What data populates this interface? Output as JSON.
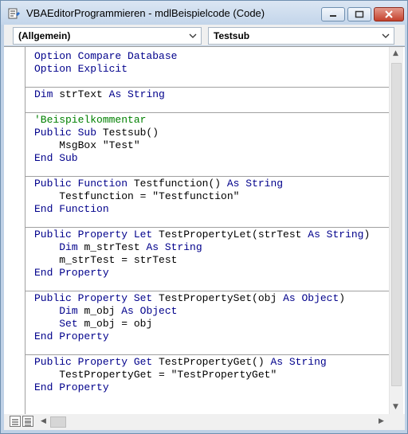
{
  "window": {
    "title": "VBAEditorProgrammieren - mdlBeispielcode (Code)",
    "icon": "vba-module-icon",
    "controls": [
      "minimize",
      "maximize",
      "close"
    ]
  },
  "object_combo": {
    "value": "(Allgemein)"
  },
  "procedure_combo": {
    "value": "Testsub"
  },
  "code_lines": [
    {
      "kind": "text",
      "segments": [
        {
          "t": "Option Compare Database",
          "c": "kw"
        }
      ]
    },
    {
      "kind": "text",
      "segments": [
        {
          "t": "Option Explicit",
          "c": "kw"
        }
      ]
    },
    {
      "kind": "blank"
    },
    {
      "kind": "text",
      "separator_before": true,
      "segments": [
        {
          "t": "Dim ",
          "c": "kw"
        },
        {
          "t": "strText ",
          "c": ""
        },
        {
          "t": "As String",
          "c": "kw"
        }
      ]
    },
    {
      "kind": "blank"
    },
    {
      "kind": "text",
      "separator_before": true,
      "segments": [
        {
          "t": "'Beispielkommentar",
          "c": "cm"
        }
      ]
    },
    {
      "kind": "text",
      "segments": [
        {
          "t": "Public Sub ",
          "c": "kw"
        },
        {
          "t": "Testsub()",
          "c": ""
        }
      ]
    },
    {
      "kind": "text",
      "segments": [
        {
          "t": "    MsgBox \"Test\"",
          "c": ""
        }
      ]
    },
    {
      "kind": "text",
      "segments": [
        {
          "t": "End Sub",
          "c": "kw"
        }
      ]
    },
    {
      "kind": "blank"
    },
    {
      "kind": "text",
      "separator_before": true,
      "segments": [
        {
          "t": "Public Function ",
          "c": "kw"
        },
        {
          "t": "Testfunction() ",
          "c": ""
        },
        {
          "t": "As String",
          "c": "kw"
        }
      ]
    },
    {
      "kind": "text",
      "segments": [
        {
          "t": "    Testfunction = \"Testfunction\"",
          "c": ""
        }
      ]
    },
    {
      "kind": "text",
      "segments": [
        {
          "t": "End Function",
          "c": "kw"
        }
      ]
    },
    {
      "kind": "blank"
    },
    {
      "kind": "text",
      "separator_before": true,
      "segments": [
        {
          "t": "Public Property Let ",
          "c": "kw"
        },
        {
          "t": "TestPropertyLet(strTest ",
          "c": ""
        },
        {
          "t": "As String",
          "c": "kw"
        },
        {
          "t": ")",
          "c": ""
        }
      ]
    },
    {
      "kind": "text",
      "segments": [
        {
          "t": "    ",
          "c": ""
        },
        {
          "t": "Dim ",
          "c": "kw"
        },
        {
          "t": "m_strTest ",
          "c": ""
        },
        {
          "t": "As String",
          "c": "kw"
        }
      ]
    },
    {
      "kind": "text",
      "segments": [
        {
          "t": "    m_strTest = strTest",
          "c": ""
        }
      ]
    },
    {
      "kind": "text",
      "segments": [
        {
          "t": "End Property",
          "c": "kw"
        }
      ]
    },
    {
      "kind": "blank"
    },
    {
      "kind": "text",
      "separator_before": true,
      "segments": [
        {
          "t": "Public Property Set ",
          "c": "kw"
        },
        {
          "t": "TestPropertySet(obj ",
          "c": ""
        },
        {
          "t": "As Object",
          "c": "kw"
        },
        {
          "t": ")",
          "c": ""
        }
      ]
    },
    {
      "kind": "text",
      "segments": [
        {
          "t": "    ",
          "c": ""
        },
        {
          "t": "Dim ",
          "c": "kw"
        },
        {
          "t": "m_obj ",
          "c": ""
        },
        {
          "t": "As Object",
          "c": "kw"
        }
      ]
    },
    {
      "kind": "text",
      "segments": [
        {
          "t": "    ",
          "c": ""
        },
        {
          "t": "Set ",
          "c": "kw"
        },
        {
          "t": "m_obj = obj",
          "c": ""
        }
      ]
    },
    {
      "kind": "text",
      "segments": [
        {
          "t": "End Property",
          "c": "kw"
        }
      ]
    },
    {
      "kind": "blank"
    },
    {
      "kind": "text",
      "separator_before": true,
      "segments": [
        {
          "t": "Public Property Get ",
          "c": "kw"
        },
        {
          "t": "TestPropertyGet() ",
          "c": ""
        },
        {
          "t": "As String",
          "c": "kw"
        }
      ]
    },
    {
      "kind": "text",
      "segments": [
        {
          "t": "    TestPropertyGet = \"TestPropertyGet\"",
          "c": ""
        }
      ]
    },
    {
      "kind": "text",
      "segments": [
        {
          "t": "End Property",
          "c": "kw"
        }
      ]
    }
  ],
  "colors": {
    "keyword": "#00008b",
    "comment": "#008000",
    "text": "#000000"
  }
}
